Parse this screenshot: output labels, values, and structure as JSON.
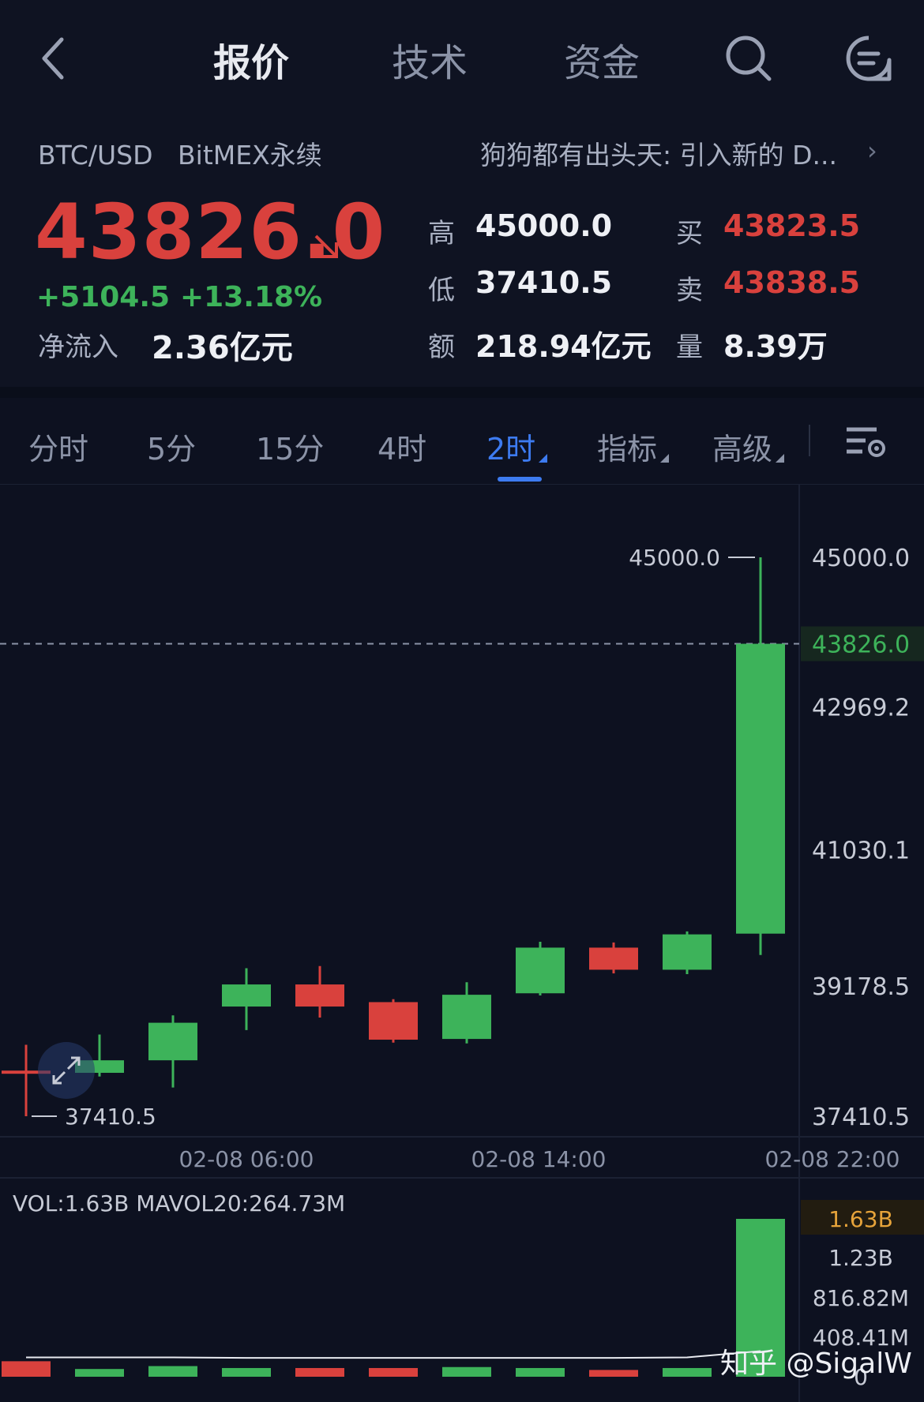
{
  "header": {
    "tabs": [
      {
        "label": "报价",
        "active": true
      },
      {
        "label": "技术",
        "active": false
      },
      {
        "label": "资金",
        "active": false
      }
    ],
    "icons": [
      "back-chevron-icon",
      "search-icon",
      "message-menu-icon"
    ]
  },
  "quote": {
    "pair": "BTC/USD",
    "exchange": "BitMEX永续",
    "news": "狗狗都有出头天: 引入新的 D...",
    "price": "43826.0",
    "change": "+5104.5",
    "change_pct": "+13.18%",
    "inflow_label": "净流入",
    "inflow_value": "2.36亿元",
    "stats": {
      "high_label": "高",
      "high": "45000.0",
      "low_label": "低",
      "low": "37410.5",
      "amount_label": "额",
      "amount": "218.94亿元",
      "bid_label": "买",
      "bid": "43823.5",
      "ask_label": "卖",
      "ask": "43838.5",
      "volume_label": "量",
      "volume": "8.39万"
    }
  },
  "timeframes": {
    "items": [
      {
        "label": "分时",
        "active": false,
        "dropdown": false
      },
      {
        "label": "5分",
        "active": false,
        "dropdown": false
      },
      {
        "label": "15分",
        "active": false,
        "dropdown": false
      },
      {
        "label": "4时",
        "active": false,
        "dropdown": false
      },
      {
        "label": "2时",
        "active": true,
        "dropdown": true
      },
      {
        "label": "指标",
        "active": false,
        "dropdown": true
      },
      {
        "label": "高级",
        "active": false,
        "dropdown": true
      }
    ]
  },
  "colors": {
    "up": "#3db35a",
    "down": "#d9413d",
    "accent": "#3d7bf0",
    "background": "#0d1120",
    "vol_highlight": "#e6a33a"
  },
  "chart_data": {
    "type": "candlestick",
    "price_axis": {
      "ylim": [
        37410.5,
        45000.0
      ],
      "ticks": [
        "45000.0",
        "42969.2",
        "41030.1",
        "39178.5",
        "37410.5"
      ],
      "current_label": "43826.0",
      "current_value": 43826.0,
      "high_marker": "45000.0",
      "low_marker": "37410.5"
    },
    "x_ticks": [
      "02-08 06:00",
      "02-08 14:00",
      "02-08 22:00"
    ],
    "candles": [
      {
        "open": 38030,
        "close": 38030,
        "high": 38380,
        "low": 37410.5
      },
      {
        "open": 38000,
        "close": 38170,
        "high": 38520,
        "low": 37950
      },
      {
        "open": 38170,
        "close": 38680,
        "high": 38780,
        "low": 37800
      },
      {
        "open": 38900,
        "close": 39200,
        "high": 39420,
        "low": 38580
      },
      {
        "open": 39200,
        "close": 38900,
        "high": 39450,
        "low": 38750
      },
      {
        "open": 38960,
        "close": 38450,
        "high": 39000,
        "low": 38410
      },
      {
        "open": 38460,
        "close": 39060,
        "high": 39230,
        "low": 38400
      },
      {
        "open": 39080,
        "close": 39700,
        "high": 39780,
        "low": 39050
      },
      {
        "open": 39700,
        "close": 39400,
        "high": 39770,
        "low": 39350
      },
      {
        "open": 39400,
        "close": 39880,
        "high": 39920,
        "low": 39340
      },
      {
        "open": 39890,
        "close": 43826,
        "high": 45000,
        "low": 39600
      }
    ],
    "volume": {
      "header": "VOL:1.63B MAVOL20:264.73M",
      "ylim_max": 1630000000.0,
      "ticks": [
        "1.63B",
        "1.23B",
        "816.82M",
        "408.41M",
        "0"
      ],
      "tick_values": [
        1630000000.0,
        1230000000.0,
        816820000.0,
        408410000.0,
        0
      ],
      "values": [
        160000000.0,
        80000000.0,
        110000000.0,
        90000000.0,
        90000000.0,
        90000000.0,
        100000000.0,
        90000000.0,
        70000000.0,
        90000000.0,
        1630000000.0
      ],
      "mavol": [
        200000000.0,
        200000000.0,
        200000000.0,
        195000000.0,
        195000000.0,
        195000000.0,
        195000000.0,
        195000000.0,
        195000000.0,
        200000000.0,
        265000000.0
      ]
    }
  },
  "watermark": "知乎 @SigalW"
}
